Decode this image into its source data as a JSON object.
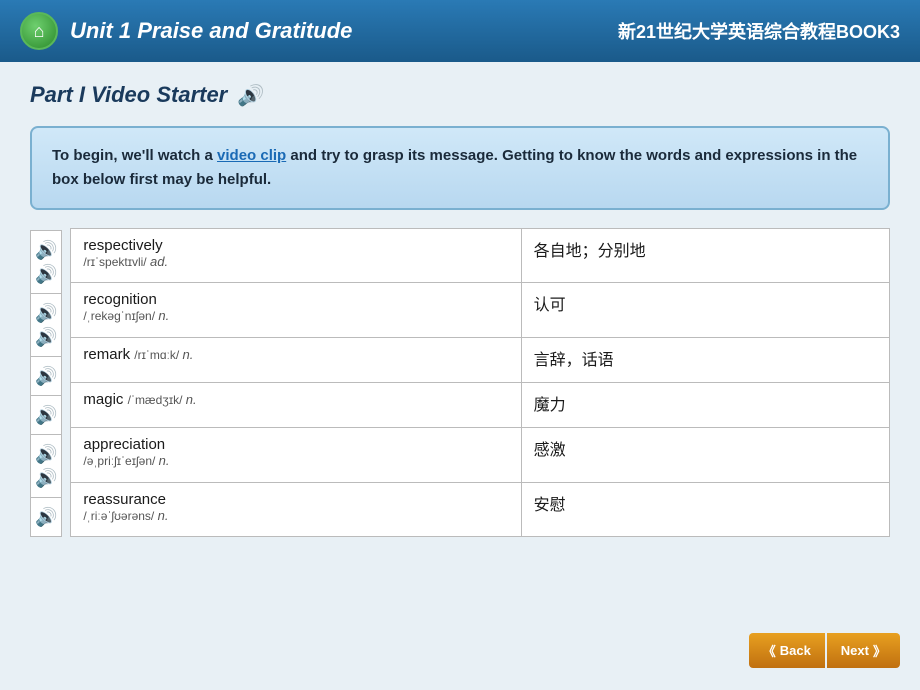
{
  "header": {
    "title": "Unit 1 Praise and Gratitude",
    "subtitle": "新21世纪大学英语综合教程BOOK3",
    "home_icon": "⌂"
  },
  "part": {
    "label": "Part I  Video Starter",
    "speaker_icon": "🔊"
  },
  "info_box": {
    "text_before": "To begin, we",
    "apostrophe": "'",
    "text_middle": "ll watch a ",
    "link_text": "video clip",
    "text_after": " and try to grasp its message. Getting to know the words and expressions in the box below first may be helpful."
  },
  "vocabulary": [
    {
      "word": "respectively",
      "phonetic": "/rɪˈspektɪvli/",
      "pos": "ad.",
      "meaning": "各自地；分别地"
    },
    {
      "word": "recognition",
      "phonetic": "/ˌrekəɡˈnɪʃən/",
      "pos": "n.",
      "meaning": "认可"
    },
    {
      "word": "remark",
      "phonetic": "/rɪˈmɑːk/",
      "pos": "n.",
      "meaning": "言辞，话语"
    },
    {
      "word": "magic",
      "phonetic": "/ˈmædʒɪk/",
      "pos": "n.",
      "meaning": "魔力"
    },
    {
      "word": "appreciation",
      "phonetic": "/əˌpriːʃɪˈeɪʃən/",
      "pos": "n.",
      "meaning": "感激"
    },
    {
      "word": "reassurance",
      "phonetic": "/ˌriːəˈʃʊərəns/",
      "pos": "n.",
      "meaning": "安慰"
    }
  ],
  "nav": {
    "back_label": "Back",
    "next_label": "Next",
    "back_arrow": "《",
    "next_arrow": "》"
  }
}
